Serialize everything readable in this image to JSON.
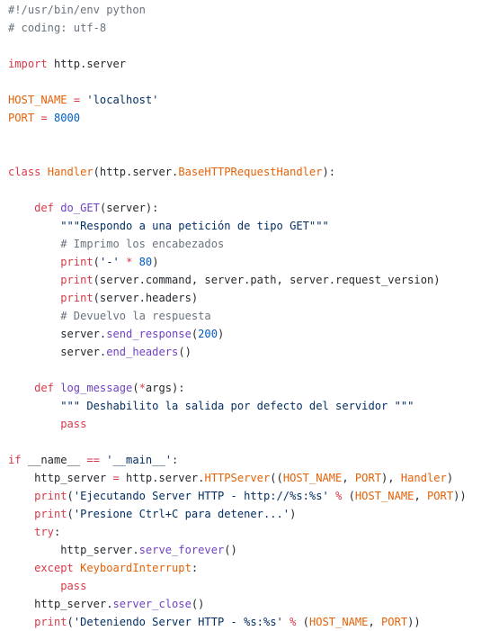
{
  "colors": {
    "background": "#ffffff",
    "plain": "#24292e",
    "comment": "#6a737d",
    "keyword": "#d73a49",
    "entity": "#e36209",
    "builtin": "#6f42c1",
    "string": "#032f62",
    "number": "#005cc5",
    "operator": "#d73a49"
  },
  "code": {
    "language": "python",
    "lines": [
      [
        [
          "comment",
          "#!/usr/bin/env python"
        ]
      ],
      [
        [
          "comment",
          "# coding: utf-8"
        ]
      ],
      [],
      [
        [
          "keyword",
          "import"
        ],
        [
          "plain",
          " http.server"
        ]
      ],
      [],
      [
        [
          "entity",
          "HOST_NAME"
        ],
        [
          "plain",
          " "
        ],
        [
          "operator",
          "="
        ],
        [
          "plain",
          " "
        ],
        [
          "string",
          "'localhost'"
        ]
      ],
      [
        [
          "entity",
          "PORT"
        ],
        [
          "plain",
          " "
        ],
        [
          "operator",
          "="
        ],
        [
          "plain",
          " "
        ],
        [
          "number",
          "8000"
        ]
      ],
      [],
      [],
      [
        [
          "keyword",
          "class"
        ],
        [
          "plain",
          " "
        ],
        [
          "entity",
          "Handler"
        ],
        [
          "plain",
          "(http.server."
        ],
        [
          "entity",
          "BaseHTTPRequestHandler"
        ],
        [
          "plain",
          "):"
        ]
      ],
      [],
      [
        [
          "plain",
          "    "
        ],
        [
          "keyword",
          "def"
        ],
        [
          "plain",
          " "
        ],
        [
          "builtin",
          "do_GET"
        ],
        [
          "plain",
          "(server):"
        ]
      ],
      [
        [
          "plain",
          "        "
        ],
        [
          "string",
          "\"\"\"Respondo a una petición de tipo GET\"\"\""
        ]
      ],
      [
        [
          "plain",
          "        "
        ],
        [
          "comment",
          "# Imprimo los encabezados"
        ]
      ],
      [
        [
          "plain",
          "        "
        ],
        [
          "keyword",
          "print"
        ],
        [
          "plain",
          "("
        ],
        [
          "string",
          "'-'"
        ],
        [
          "plain",
          " "
        ],
        [
          "operator",
          "*"
        ],
        [
          "plain",
          " "
        ],
        [
          "number",
          "80"
        ],
        [
          "plain",
          ")"
        ]
      ],
      [
        [
          "plain",
          "        "
        ],
        [
          "keyword",
          "print"
        ],
        [
          "plain",
          "(server.command, server.path, server.request_version)"
        ]
      ],
      [
        [
          "plain",
          "        "
        ],
        [
          "keyword",
          "print"
        ],
        [
          "plain",
          "(server.headers)"
        ]
      ],
      [
        [
          "plain",
          "        "
        ],
        [
          "comment",
          "# Devuelvo la respuesta"
        ]
      ],
      [
        [
          "plain",
          "        server."
        ],
        [
          "builtin",
          "send_response"
        ],
        [
          "plain",
          "("
        ],
        [
          "number",
          "200"
        ],
        [
          "plain",
          ")"
        ]
      ],
      [
        [
          "plain",
          "        server."
        ],
        [
          "builtin",
          "end_headers"
        ],
        [
          "plain",
          "()"
        ]
      ],
      [],
      [
        [
          "plain",
          "    "
        ],
        [
          "keyword",
          "def"
        ],
        [
          "plain",
          " "
        ],
        [
          "builtin",
          "log_message"
        ],
        [
          "plain",
          "("
        ],
        [
          "operator",
          "*"
        ],
        [
          "plain",
          "args):"
        ]
      ],
      [
        [
          "plain",
          "        "
        ],
        [
          "string",
          "\"\"\" Deshabilito la salida por defecto del servidor \"\"\""
        ]
      ],
      [
        [
          "plain",
          "        "
        ],
        [
          "keyword",
          "pass"
        ]
      ],
      [],
      [
        [
          "keyword",
          "if"
        ],
        [
          "plain",
          " __name__ "
        ],
        [
          "operator",
          "=="
        ],
        [
          "plain",
          " "
        ],
        [
          "string",
          "'__main__'"
        ],
        [
          "plain",
          ":"
        ]
      ],
      [
        [
          "plain",
          "    http_server "
        ],
        [
          "operator",
          "="
        ],
        [
          "plain",
          " http.server."
        ],
        [
          "entity",
          "HTTPServer"
        ],
        [
          "plain",
          "(("
        ],
        [
          "entity",
          "HOST_NAME"
        ],
        [
          "plain",
          ", "
        ],
        [
          "entity",
          "PORT"
        ],
        [
          "plain",
          "), "
        ],
        [
          "entity",
          "Handler"
        ],
        [
          "plain",
          ")"
        ]
      ],
      [
        [
          "plain",
          "    "
        ],
        [
          "keyword",
          "print"
        ],
        [
          "plain",
          "("
        ],
        [
          "string",
          "'Ejecutando Server HTTP - http://%s:%s'"
        ],
        [
          "plain",
          " "
        ],
        [
          "operator",
          "%"
        ],
        [
          "plain",
          " ("
        ],
        [
          "entity",
          "HOST_NAME"
        ],
        [
          "plain",
          ", "
        ],
        [
          "entity",
          "PORT"
        ],
        [
          "plain",
          "))"
        ]
      ],
      [
        [
          "plain",
          "    "
        ],
        [
          "keyword",
          "print"
        ],
        [
          "plain",
          "("
        ],
        [
          "string",
          "'Presione Ctrl+C para detener...'"
        ],
        [
          "plain",
          ")"
        ]
      ],
      [
        [
          "plain",
          "    "
        ],
        [
          "keyword",
          "try"
        ],
        [
          "plain",
          ":"
        ]
      ],
      [
        [
          "plain",
          "        http_server."
        ],
        [
          "builtin",
          "serve_forever"
        ],
        [
          "plain",
          "()"
        ]
      ],
      [
        [
          "plain",
          "    "
        ],
        [
          "keyword",
          "except"
        ],
        [
          "plain",
          " "
        ],
        [
          "entity",
          "KeyboardInterrupt"
        ],
        [
          "plain",
          ":"
        ]
      ],
      [
        [
          "plain",
          "        "
        ],
        [
          "keyword",
          "pass"
        ]
      ],
      [
        [
          "plain",
          "    http_server."
        ],
        [
          "builtin",
          "server_close"
        ],
        [
          "plain",
          "()"
        ]
      ],
      [
        [
          "plain",
          "    "
        ],
        [
          "keyword",
          "print"
        ],
        [
          "plain",
          "("
        ],
        [
          "string",
          "'Deteniendo Server HTTP - %s:%s'"
        ],
        [
          "plain",
          " "
        ],
        [
          "operator",
          "%"
        ],
        [
          "plain",
          " ("
        ],
        [
          "entity",
          "HOST_NAME"
        ],
        [
          "plain",
          ", "
        ],
        [
          "entity",
          "PORT"
        ],
        [
          "plain",
          "))"
        ]
      ]
    ]
  }
}
